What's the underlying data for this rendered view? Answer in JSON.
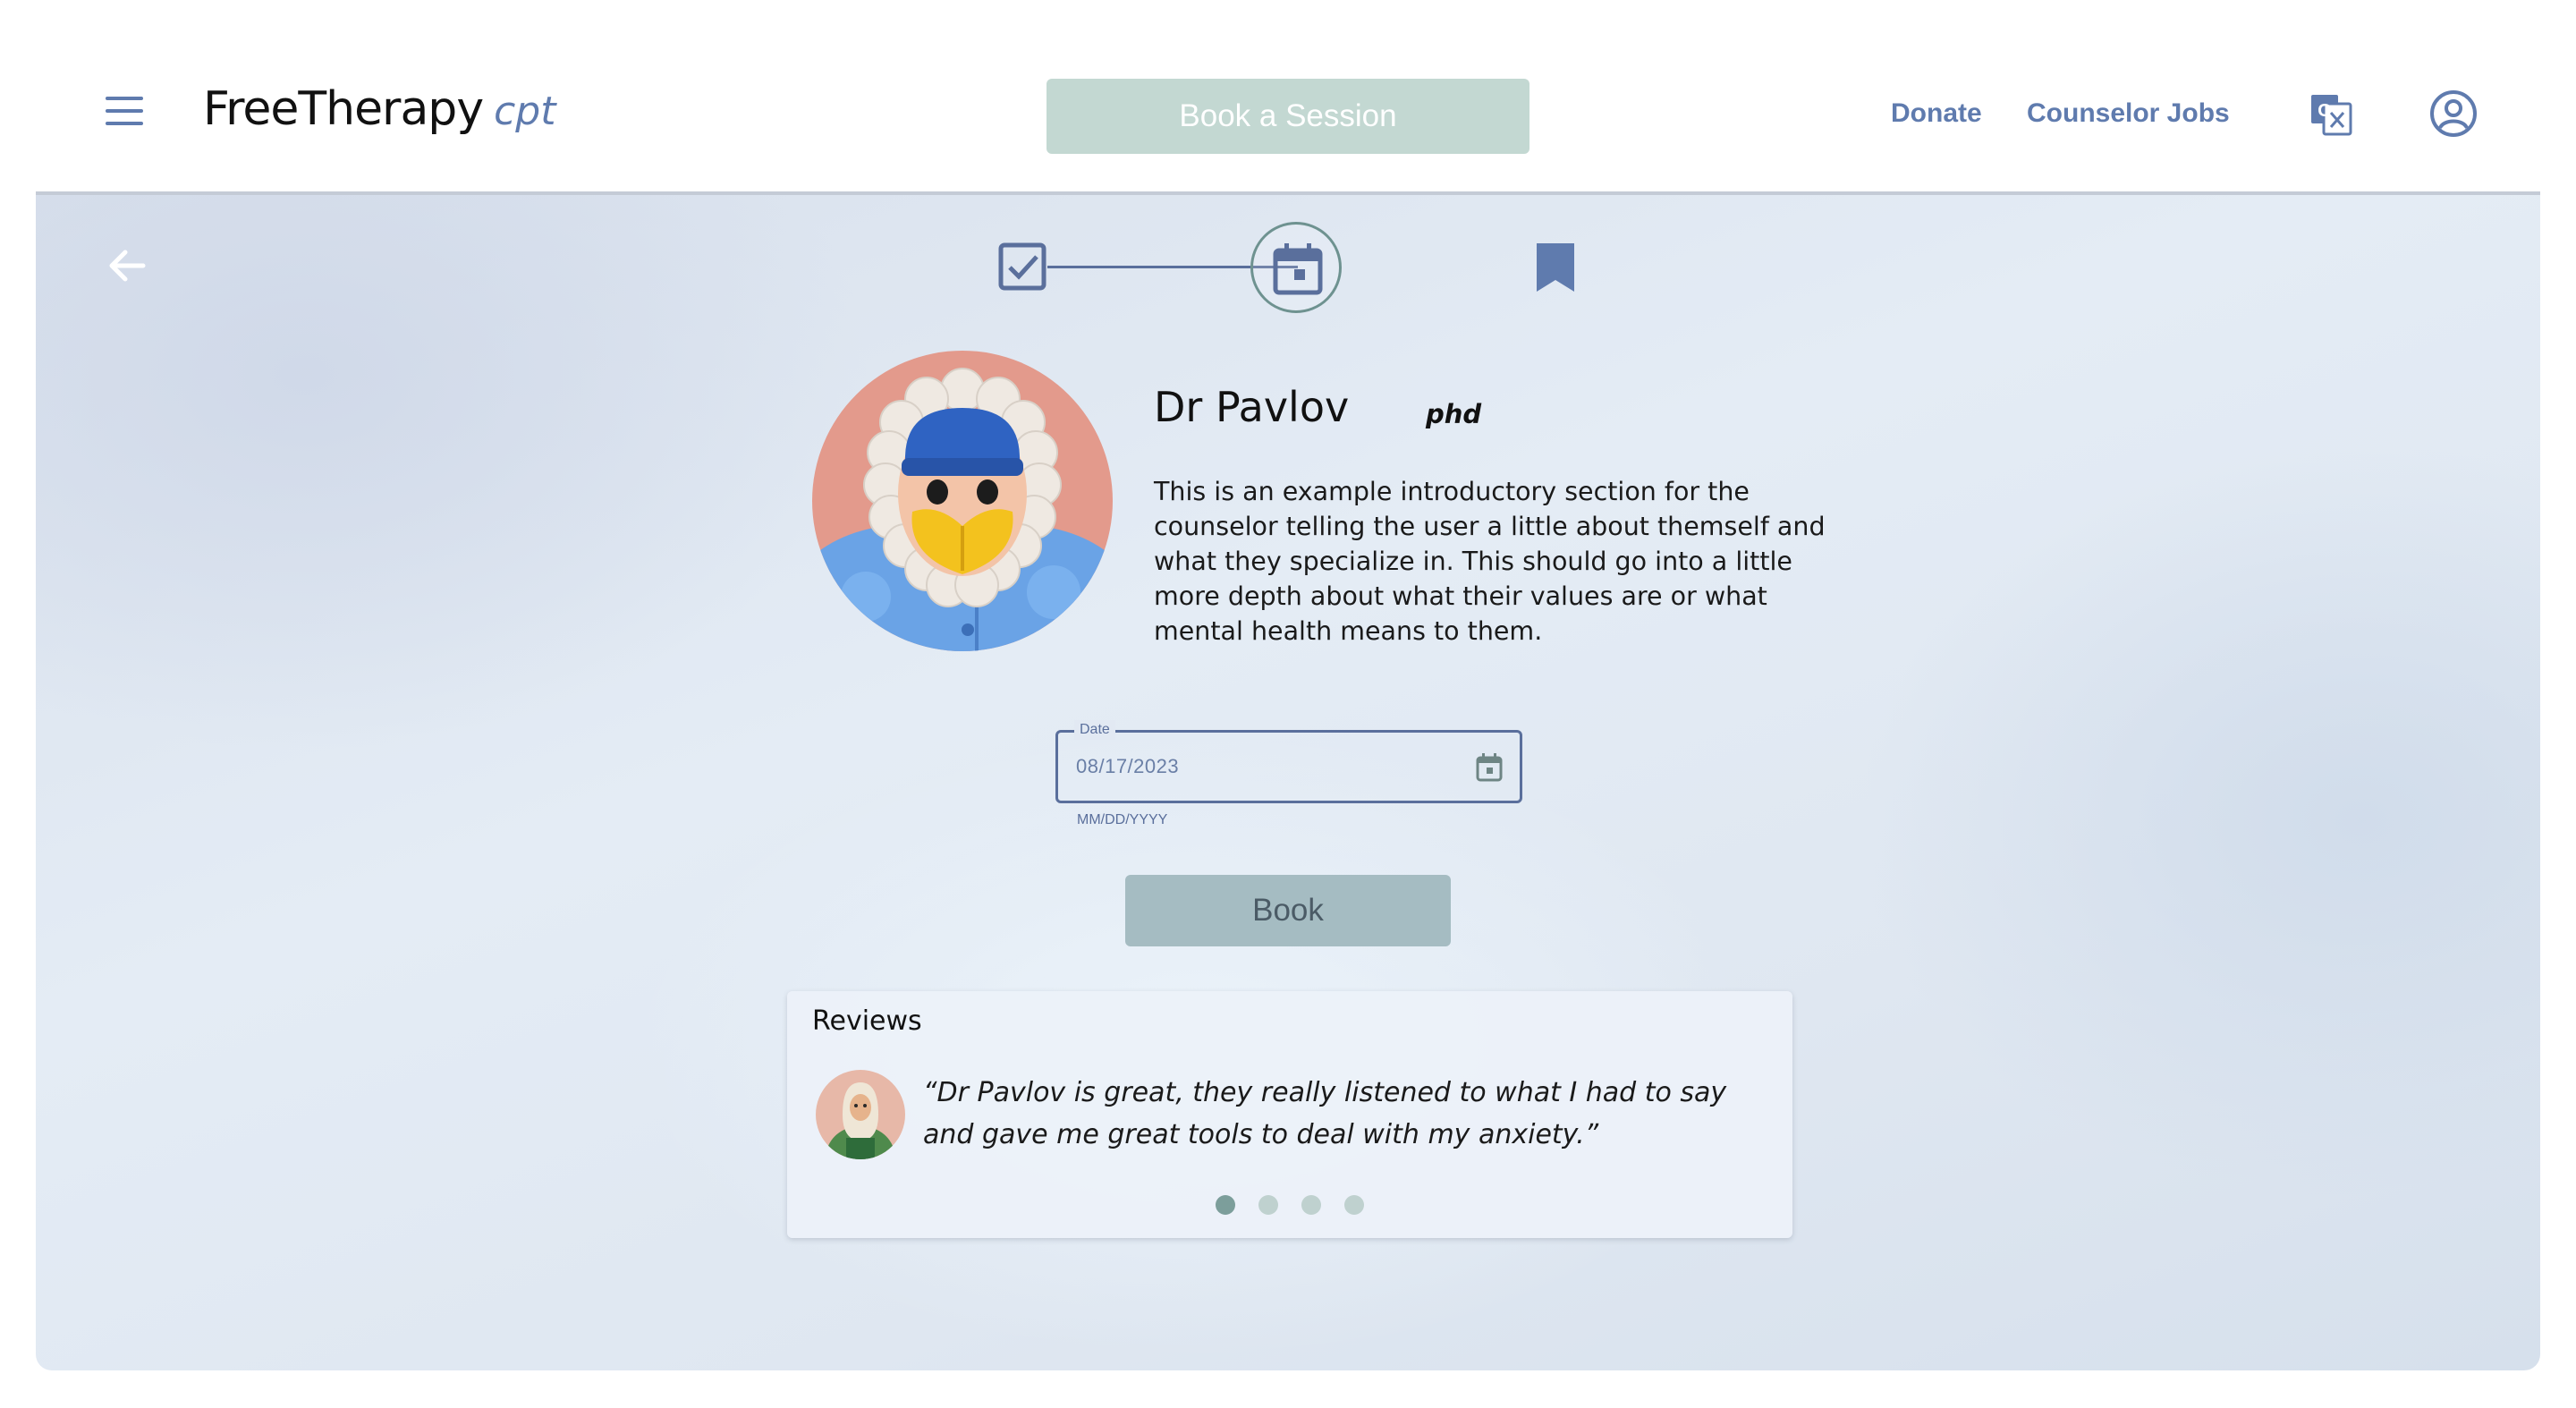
{
  "header": {
    "logo_main": "FreeTherapy",
    "logo_sub": "cpt",
    "book_session_label": "Book a Session",
    "nav": {
      "donate": "Donate",
      "counselor_jobs": "Counselor Jobs"
    },
    "icons": [
      "menu-icon",
      "translate-icon",
      "account-circle-icon"
    ]
  },
  "stepper": {
    "steps": [
      "check-box-icon",
      "calendar-icon",
      "bookmark-icon"
    ],
    "current_step": 2
  },
  "counselor": {
    "name": "Dr Pavlov",
    "credential": "phd",
    "bio": "This is an example introductory section for the counselor telling the user a little about themself and what they specialize in. This should go into a little more depth about what their values are or what mental health means to them."
  },
  "date_field": {
    "label": "Date",
    "value": "08/17/2023",
    "helper": "MM/DD/YYYY"
  },
  "book_label": "Book",
  "reviews": {
    "title": "Reviews",
    "quote": "“Dr Pavlov is great, they really listened to what I had to say and gave me great tools to deal with my anxiety.”",
    "dots": 4,
    "active_dot": 1
  },
  "colors": {
    "accent": "#5f7bae",
    "book_session_bg": "#c3d8d2",
    "book_bg": "#a5bcc2",
    "step_ring": "#6e9290",
    "dot_active": "#7c9e9b",
    "dot_inactive": "#bfd1cf"
  }
}
